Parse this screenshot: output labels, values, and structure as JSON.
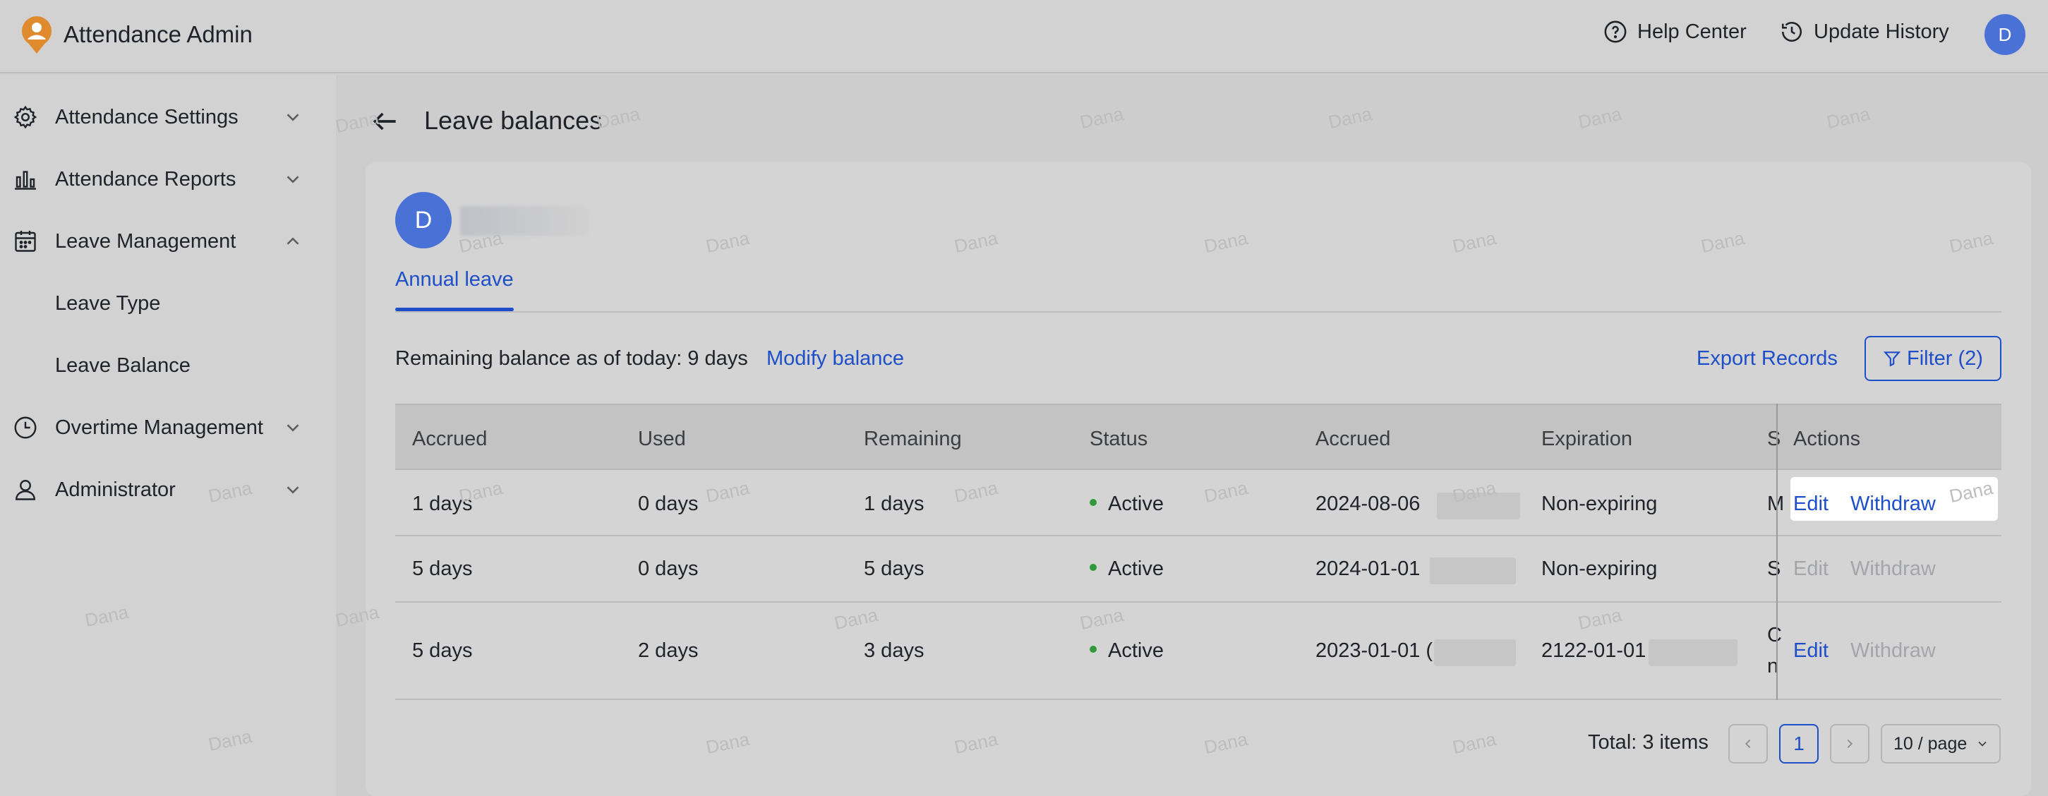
{
  "header": {
    "app_title": "Attendance Admin",
    "help_center": "Help Center",
    "update_history": "Update History",
    "avatar_initial": "D"
  },
  "sidebar": {
    "items": [
      {
        "label": "Attendance Settings",
        "icon": "gear-icon",
        "expanded": false
      },
      {
        "label": "Attendance Reports",
        "icon": "bar-chart-icon",
        "expanded": false
      },
      {
        "label": "Leave Management",
        "icon": "calendar-icon",
        "expanded": true
      },
      {
        "label": "Leave Type"
      },
      {
        "label": "Leave Balance"
      },
      {
        "label": "Overtime Management",
        "icon": "clock-icon",
        "expanded": false
      },
      {
        "label": "Administrator",
        "icon": "user-icon",
        "expanded": false
      }
    ]
  },
  "page": {
    "title": "Leave balances",
    "employee_initial": "D",
    "tab": "Annual leave",
    "remaining_text": "Remaining balance as of today: 9 days",
    "modify_balance": "Modify balance",
    "export_records": "Export Records",
    "filter_label": "Filter (2)"
  },
  "table": {
    "columns": [
      "Accrued",
      "Used",
      "Remaining",
      "Status",
      "Accrued",
      "Expiration",
      "S",
      "Actions"
    ],
    "rows": [
      {
        "accrued": "1 days",
        "used": "0 days",
        "remaining": "1 days",
        "status": "Active",
        "accrued_date": "2024-08-06",
        "expiration": "Non-expiring",
        "source": "M",
        "edit": "Edit",
        "withdraw": "Withdraw",
        "edit_enabled": true,
        "withdraw_enabled": true
      },
      {
        "accrued": "5 days",
        "used": "0 days",
        "remaining": "5 days",
        "status": "Active",
        "accrued_date": "2024-01-01",
        "expiration": "Non-expiring",
        "source": "S",
        "edit": "Edit",
        "withdraw": "Withdraw",
        "edit_enabled": false,
        "withdraw_enabled": false
      },
      {
        "accrued": "5 days",
        "used": "2 days",
        "remaining": "3 days",
        "status": "Active",
        "accrued_date": "2023-01-01 (",
        "expiration": "2122-01-01",
        "source": "C",
        "source_line2": "n",
        "edit": "Edit",
        "withdraw": "Withdraw",
        "edit_enabled": true,
        "withdraw_enabled": false
      }
    ]
  },
  "pagination": {
    "total": "Total: 3 items",
    "current_page": "1",
    "page_size": "10 / page"
  },
  "watermark": "Dana",
  "colors": {
    "accent": "#1e4fc9",
    "status_active": "#2e9a3a",
    "avatar": "#4a72d6"
  }
}
